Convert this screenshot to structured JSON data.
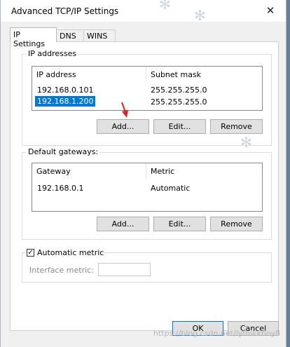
{
  "window": {
    "title": "Advanced TCP/IP Settings",
    "close_glyph": "✕"
  },
  "tabs": [
    {
      "label": "IP Settings",
      "active": true
    },
    {
      "label": "DNS",
      "active": false
    },
    {
      "label": "WINS",
      "active": false
    }
  ],
  "ip_section": {
    "legend": "IP addresses",
    "columns": [
      "IP address",
      "Subnet mask"
    ],
    "rows": [
      {
        "ip": "192.168.0.101",
        "mask": "255.255.255.0",
        "selected": false
      },
      {
        "ip": "192.168.1.200",
        "mask": "255.255.255.0",
        "selected": true
      }
    ],
    "buttons": {
      "add": "Add...",
      "edit": "Edit...",
      "remove": "Remove"
    }
  },
  "gateway_section": {
    "legend": "Default gateways:",
    "columns": [
      "Gateway",
      "Metric"
    ],
    "rows": [
      {
        "gateway": "192.168.0.1",
        "metric": "Automatic"
      }
    ],
    "buttons": {
      "add": "Add...",
      "edit": "Edit...",
      "remove": "Remove"
    }
  },
  "metric_section": {
    "automatic_metric_label": "Automatic metric",
    "automatic_metric_checked": true,
    "interface_metric_label": "Interface metric:",
    "interface_metric_value": ""
  },
  "footer": {
    "ok": "OK",
    "cancel": "Cancel"
  },
  "watermark": "https://blog.csdn.net/lyfnikkboy8"
}
